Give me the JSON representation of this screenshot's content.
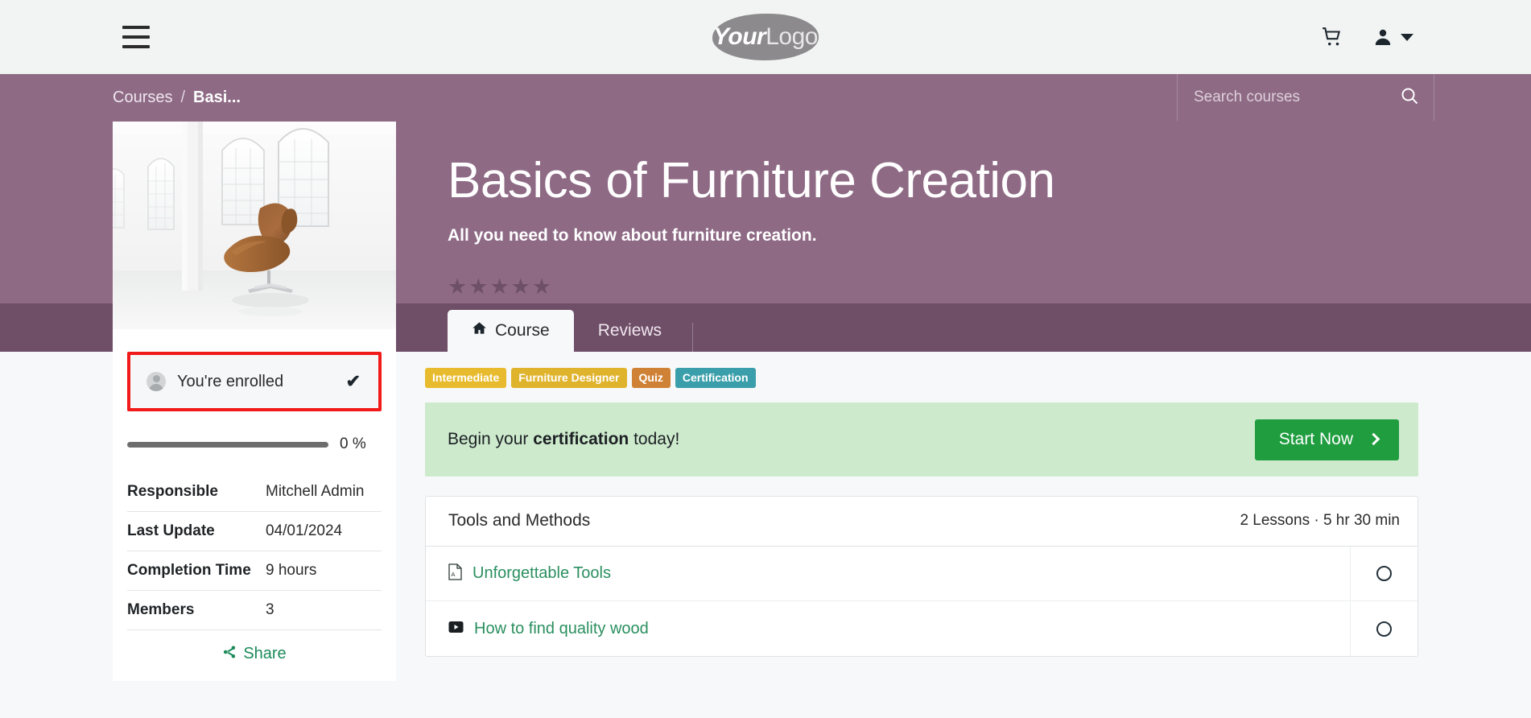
{
  "header": {
    "menu_icon": "hamburger-icon",
    "logo_primary": "Your",
    "logo_secondary": "Logo",
    "cart_icon": "shopping-cart-icon",
    "user_icon": "user-account-icon"
  },
  "breadcrumb": {
    "root": "Courses",
    "separator": "/",
    "current": "Basi..."
  },
  "search": {
    "placeholder": "Search courses",
    "value": "",
    "icon": "search-icon"
  },
  "hero": {
    "title": "Basics of Furniture Creation",
    "subtitle": "All you need to know about furniture creation.",
    "rating_stars": 5,
    "rating_filled": 0
  },
  "tabs": [
    {
      "label": "Course",
      "icon": "home-icon",
      "active": true
    },
    {
      "label": "Reviews",
      "icon": "",
      "active": false
    }
  ],
  "sidebar": {
    "thumbnail_alt": "white-loft-interior-with-brown-egg-chair",
    "enrolled": {
      "label": "You're enrolled",
      "avatar_icon": "user-avatar-icon",
      "check_icon": "✔"
    },
    "progress": {
      "percent": 0,
      "label": "0 %"
    },
    "info": [
      {
        "key": "Responsible",
        "value": "Mitchell Admin"
      },
      {
        "key": "Last Update",
        "value": "04/01/2024"
      },
      {
        "key": "Completion Time",
        "value": "9 hours"
      },
      {
        "key": "Members",
        "value": "3"
      }
    ],
    "share": {
      "label": "Share",
      "icon": "share-icon"
    }
  },
  "main": {
    "tags": [
      {
        "label": "Intermediate",
        "color": "#e8bb2e"
      },
      {
        "label": "Furniture Designer",
        "color": "#e0b32c"
      },
      {
        "label": "Quiz",
        "color": "#cf8236"
      },
      {
        "label": "Certification",
        "color": "#3a9faa"
      }
    ],
    "certification_banner": {
      "text_before": "Begin your ",
      "text_bold": "certification",
      "text_after": " today!",
      "button_label": "Start Now",
      "button_icon": "chevron-right-icon",
      "bg_color": "#cdeacd",
      "button_color": "#1f9d3f"
    },
    "lessons_section": {
      "title": "Tools and Methods",
      "meta": "2 Lessons · 5 hr 30 min",
      "lessons": [
        {
          "name": "Unforgettable Tools",
          "icon": "pdf-file-icon",
          "completed": false
        },
        {
          "name": "How to find quality wood",
          "icon": "video-play-icon",
          "completed": false
        }
      ]
    }
  }
}
